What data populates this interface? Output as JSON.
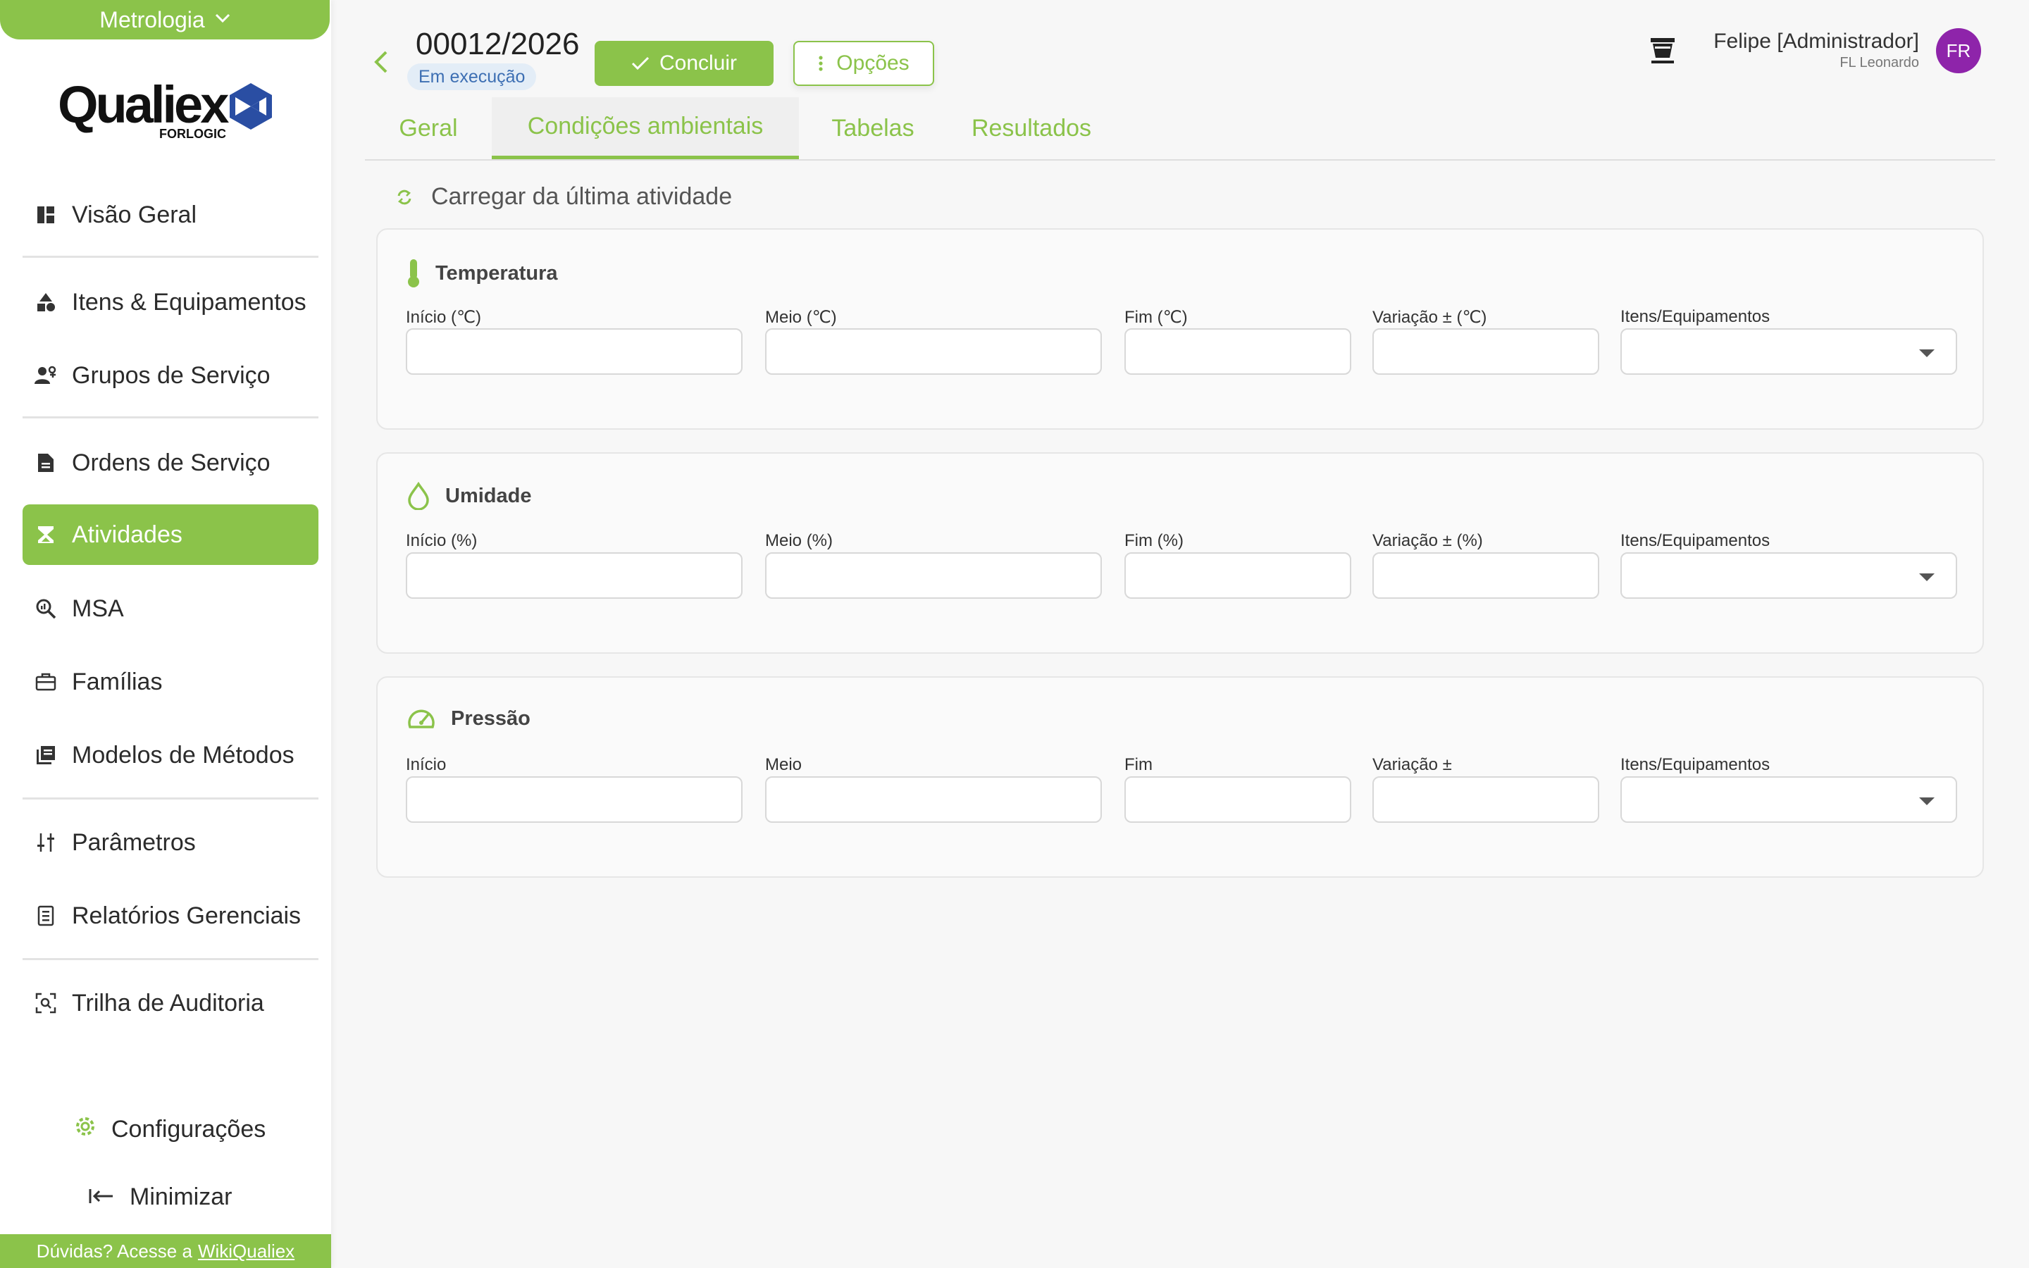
{
  "sidebar": {
    "module": "Metrologia",
    "logo": {
      "brand": "Qualiex",
      "sub": "FORLOGIC"
    },
    "items": [
      {
        "label": "Visão Geral",
        "icon": "dashboard-icon"
      },
      {
        "label": "Itens & Equipamentos",
        "icon": "shapes-icon"
      },
      {
        "label": "Grupos de Serviço",
        "icon": "people-icon"
      },
      {
        "label": "Ordens de Serviço",
        "icon": "document-icon"
      },
      {
        "label": "Atividades",
        "icon": "hourglass-icon"
      },
      {
        "label": "MSA",
        "icon": "zoom-analysis-icon"
      },
      {
        "label": "Famílias",
        "icon": "toolbox-icon"
      },
      {
        "label": "Modelos de Métodos",
        "icon": "library-icon"
      },
      {
        "label": "Parâmetros",
        "icon": "sliders-icon"
      },
      {
        "label": "Relatórios Gerenciais",
        "icon": "report-icon"
      },
      {
        "label": "Trilha de Auditoria",
        "icon": "audit-icon"
      }
    ],
    "settings_label": "Configurações",
    "minimize_label": "Minimizar",
    "help_text": "Dúvidas? Acesse a",
    "help_link": "WikiQualiex"
  },
  "header": {
    "record_id": "00012/2026",
    "status": "Em execução",
    "conclude_label": "Concluir",
    "options_label": "Opções",
    "user_name": "Felipe [Administrador]",
    "user_org": "FL Leonardo",
    "avatar_initials": "FR"
  },
  "tabs": [
    {
      "label": "Geral"
    },
    {
      "label": "Condições ambientais",
      "active": true
    },
    {
      "label": "Tabelas"
    },
    {
      "label": "Resultados"
    }
  ],
  "load_last_label": "Carregar da última atividade",
  "sections": [
    {
      "title": "Temperatura",
      "icon": "thermometer-icon",
      "fields": [
        "Início (℃)",
        "Meio (℃)",
        "Fim (℃)",
        "Variação ± (℃)",
        "Itens/Equipamentos"
      ]
    },
    {
      "title": "Umidade",
      "icon": "water-drop-icon",
      "fields": [
        "Início (%)",
        "Meio (%)",
        "Fim (%)",
        "Variação ± (%)",
        "Itens/Equipamentos"
      ]
    },
    {
      "title": "Pressão",
      "icon": "gauge-icon",
      "fields": [
        "Início",
        "Meio",
        "Fim",
        "Variação ±",
        "Itens/Equipamentos"
      ]
    }
  ],
  "colors": {
    "accent": "#8bc34a",
    "avatar": "#8e24aa",
    "status_bg": "#e3edf7",
    "status_text": "#3d6fb3"
  }
}
